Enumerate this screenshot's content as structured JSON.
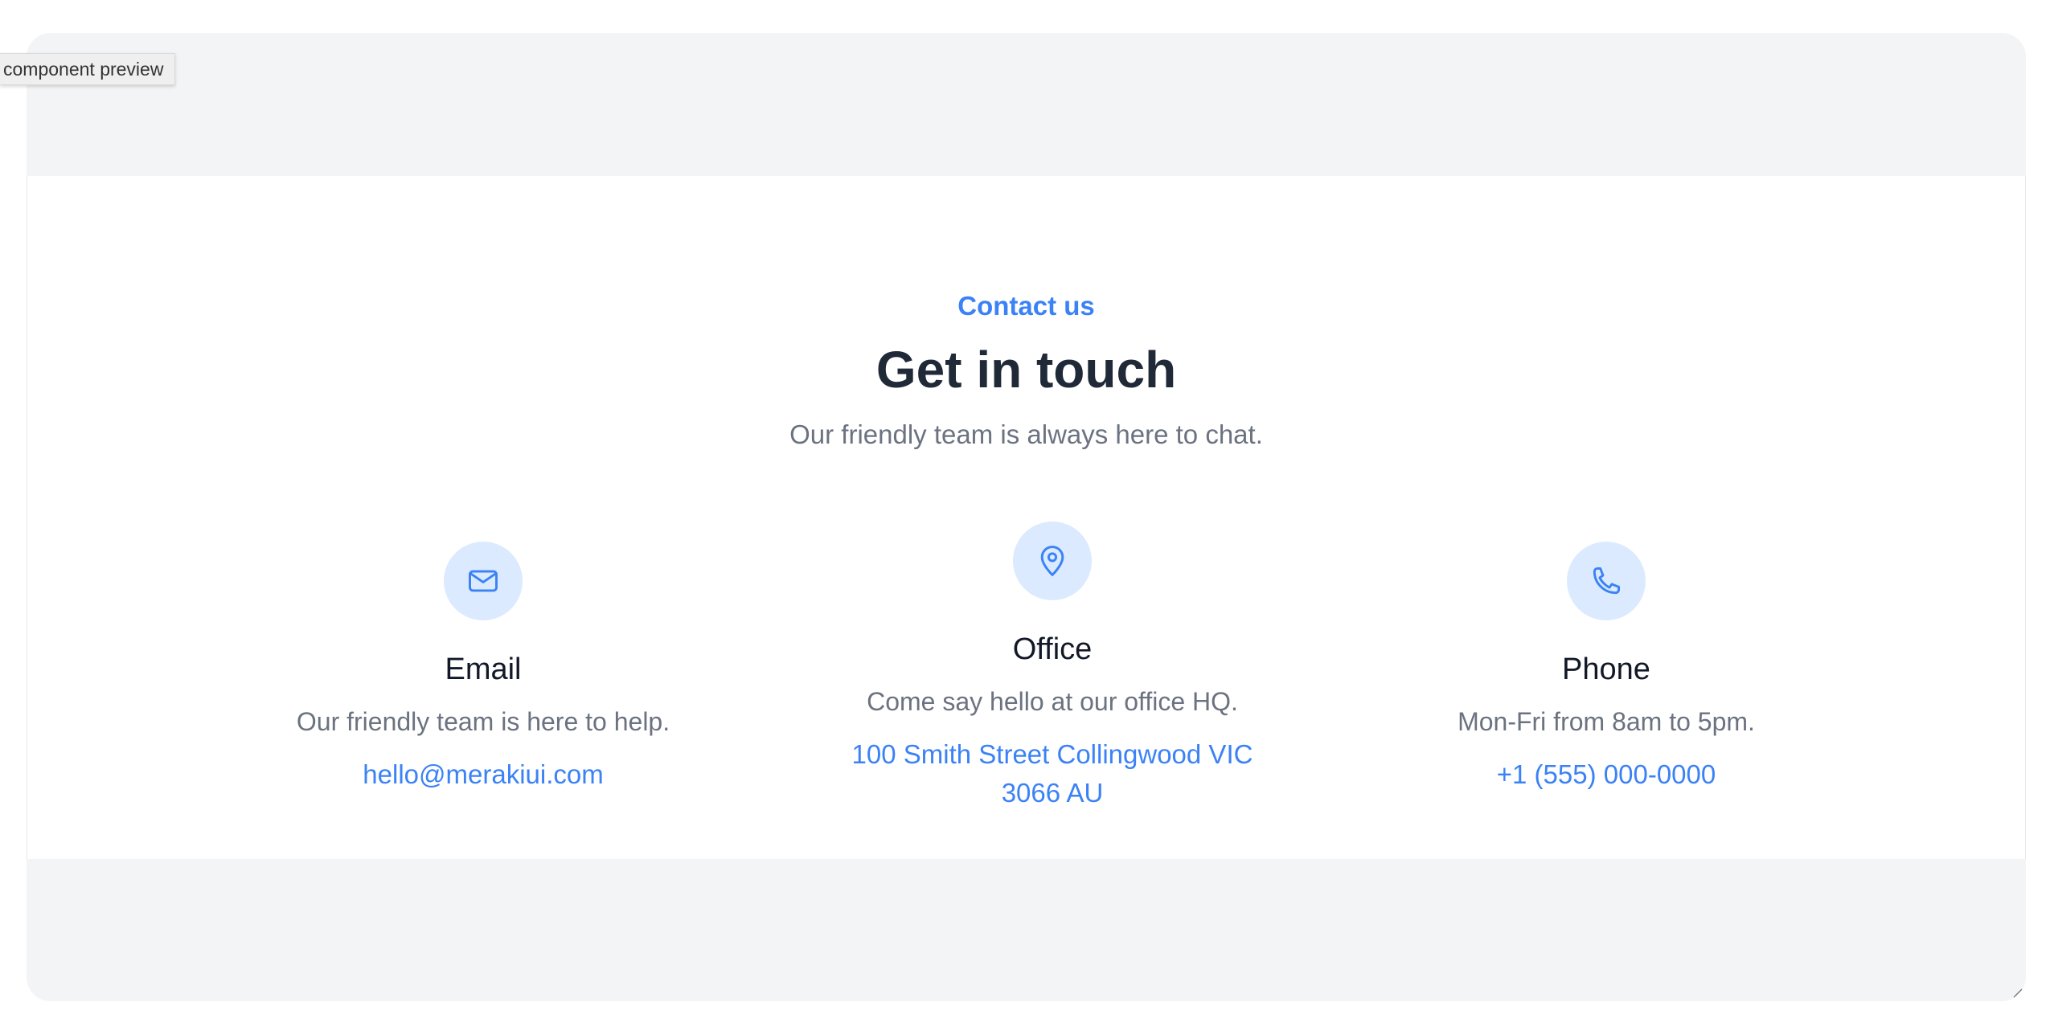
{
  "preview": {
    "tag_label": "component preview"
  },
  "contact": {
    "eyebrow": "Contact us",
    "title": "Get in touch",
    "subtitle": "Our friendly team is always here to chat.",
    "accent_color": "#3b82f6",
    "cards": [
      {
        "icon": "mail-icon",
        "title": "Email",
        "description": "Our friendly team is here to help.",
        "link": "hello@merakiui.com"
      },
      {
        "icon": "map-pin-icon",
        "title": "Office",
        "description": "Come say hello at our office HQ.",
        "link": "100 Smith Street Collingwood VIC 3066 AU"
      },
      {
        "icon": "phone-icon",
        "title": "Phone",
        "description": "Mon-Fri from 8am to 5pm.",
        "link": "+1 (555) 000-0000"
      }
    ]
  }
}
